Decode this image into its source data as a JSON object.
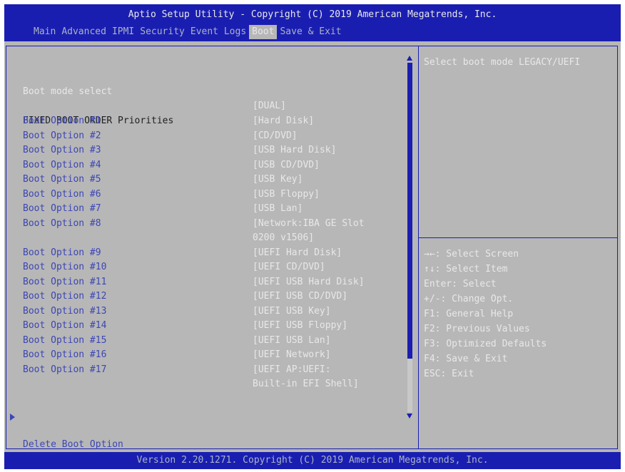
{
  "header": {
    "title": "Aptio Setup Utility - Copyright (C) 2019 American Megatrends, Inc.",
    "tabs": [
      "Main",
      "Advanced",
      "IPMI",
      "Security",
      "Event Logs",
      "Boot",
      "Save & Exit"
    ],
    "active_tab": "Boot"
  },
  "boot": {
    "mode_label": "Boot mode select",
    "mode_value": "[DUAL]",
    "section_heading": "FIXED BOOT ORDER Priorities",
    "options": [
      {
        "label": "Boot Option #1",
        "value": "[Hard Disk]"
      },
      {
        "label": "Boot Option #2",
        "value": "[CD/DVD]"
      },
      {
        "label": "Boot Option #3",
        "value": "[USB Hard Disk]"
      },
      {
        "label": "Boot Option #4",
        "value": "[USB CD/DVD]"
      },
      {
        "label": "Boot Option #5",
        "value": "[USB Key]"
      },
      {
        "label": "Boot Option #6",
        "value": "[USB Floppy]"
      },
      {
        "label": "Boot Option #7",
        "value": "[USB Lan]"
      },
      {
        "label": "Boot Option #8",
        "value": "[Network:IBA GE Slot",
        "value2": "0200 v1506]"
      },
      {
        "label": "Boot Option #9",
        "value": "[UEFI Hard Disk]"
      },
      {
        "label": "Boot Option #10",
        "value": "[UEFI CD/DVD]"
      },
      {
        "label": "Boot Option #11",
        "value": "[UEFI USB Hard Disk]"
      },
      {
        "label": "Boot Option #12",
        "value": "[UEFI USB CD/DVD]"
      },
      {
        "label": "Boot Option #13",
        "value": "[UEFI USB Key]"
      },
      {
        "label": "Boot Option #14",
        "value": "[UEFI USB Floppy]"
      },
      {
        "label": "Boot Option #15",
        "value": "[UEFI USB Lan]"
      },
      {
        "label": "Boot Option #16",
        "value": "[UEFI Network]"
      },
      {
        "label": "Boot Option #17",
        "value": "[UEFI AP:UEFI:",
        "value2": "Built-in EFI Shell]"
      }
    ],
    "delete_label": "Delete Boot Option"
  },
  "help": {
    "description": "Select boot mode LEGACY/UEFI",
    "keys": [
      "→←: Select Screen",
      "↑↓: Select Item",
      "Enter: Select",
      "+/-: Change Opt.",
      "F1: General Help",
      "F2: Previous Values",
      "F3: Optimized Defaults",
      "F4: Save & Exit",
      "ESC: Exit"
    ]
  },
  "footer": {
    "text": "Version 2.20.1271. Copyright (C) 2019 American Megatrends, Inc."
  },
  "colors": {
    "bar_blue": "#1a1eb0",
    "panel_gray": "#b7b7b7",
    "label_blue": "#3c46b6",
    "text_white": "#e8e8e8"
  }
}
